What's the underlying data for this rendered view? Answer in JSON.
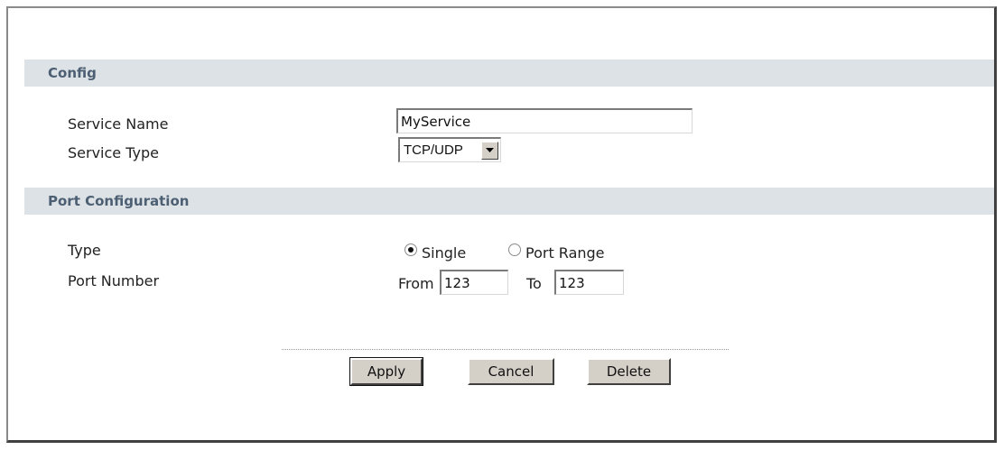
{
  "config": {
    "section_title": "Config",
    "service_name_label": "Service Name",
    "service_name_value": "MyService",
    "service_type_label": "Service Type",
    "service_type_value": "TCP/UDP"
  },
  "port_configuration": {
    "section_title": "Port Configuration",
    "type_label": "Type",
    "type_options": [
      {
        "label": "Single",
        "selected": true
      },
      {
        "label": "Port Range",
        "selected": false
      }
    ],
    "port_number_label": "Port Number",
    "from_label": "From",
    "from_value": "123",
    "to_label": "To",
    "to_value": "123"
  },
  "actions": {
    "apply_label": "Apply",
    "cancel_label": "Cancel",
    "delete_label": "Delete"
  }
}
